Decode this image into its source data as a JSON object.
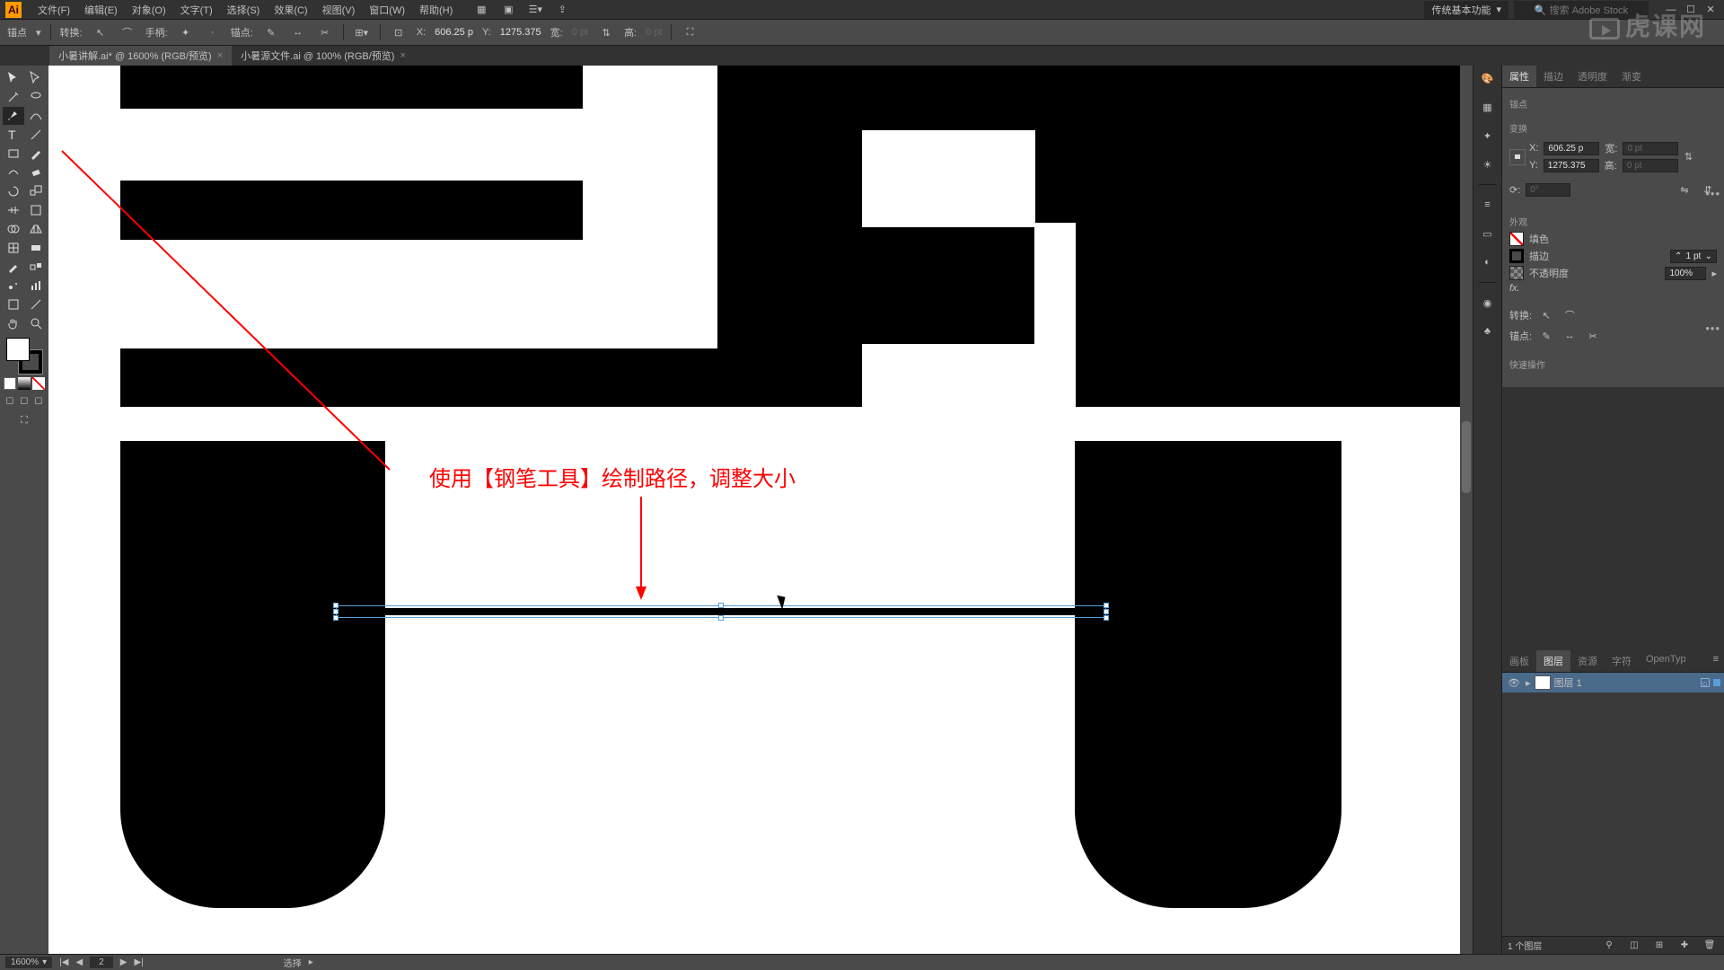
{
  "menubar": {
    "items": [
      "文件(F)",
      "编辑(E)",
      "对象(O)",
      "文字(T)",
      "选择(S)",
      "效果(C)",
      "视图(V)",
      "窗口(W)",
      "帮助(H)"
    ]
  },
  "titlebar": {
    "workspace": "传统基本功能",
    "search_placeholder": "搜索 Adobe Stock"
  },
  "optionsbar": {
    "left_label": "锚点",
    "convert_label": "转换:",
    "handle_label": "手柄:",
    "anchor_label": "锚点:",
    "x_label": "X:",
    "x_val": "606.25 p",
    "y_label": "Y:",
    "y_val": "1275.375",
    "w_label": "宽:",
    "w_val": "0 pt",
    "h_label": "高:",
    "h_val": "0 pt"
  },
  "tabs": [
    {
      "label": "小暑讲解.ai* @ 1600% (RGB/预览)",
      "active": true
    },
    {
      "label": "小暑源文件.ai @ 100% (RGB/预览)",
      "active": false
    }
  ],
  "annotation_text": "使用【钢笔工具】绘制路径，调整大小",
  "properties": {
    "tabs": [
      "属性",
      "描边",
      "透明度",
      "渐变"
    ],
    "title": "锚点",
    "transform_label": "变换",
    "x_label": "X:",
    "x_val": "606.25 p",
    "y_label": "Y:",
    "y_val": "1275.375",
    "w_label": "宽:",
    "w_val": "0 pt",
    "h_label": "高:",
    "h_val": "0 pt",
    "angle_label": "⟳:",
    "angle_val": "0°",
    "appearance_label": "外观",
    "fill_label": "填色",
    "stroke_label": "描边",
    "stroke_val": "1 pt",
    "opacity_label": "不透明度",
    "opacity_val": "100%",
    "fx_label": "fx.",
    "convert_label": "转换:",
    "anchor_label": "锚点:",
    "quick_label": "快速操作"
  },
  "layers": {
    "tabs": [
      "画板",
      "图层",
      "资源",
      "字符",
      "OpenTyp"
    ],
    "layer1": "图层 1",
    "footer": "1 个图层"
  },
  "statusbar": {
    "zoom": "1600%",
    "page": "2",
    "mode": "选择"
  },
  "watermark": "虎课网"
}
